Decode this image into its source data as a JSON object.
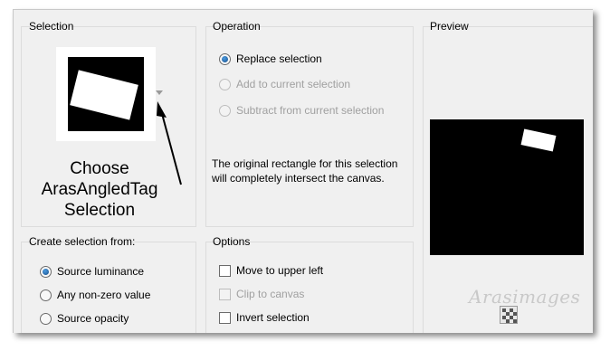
{
  "selection": {
    "title": "Selection",
    "annotation_lines": [
      "Choose",
      "ArasAngledTag",
      "Selection"
    ]
  },
  "operation": {
    "title": "Operation",
    "options": [
      {
        "label": "Replace selection",
        "checked": true,
        "enabled": true
      },
      {
        "label": "Add to current selection",
        "checked": false,
        "enabled": false
      },
      {
        "label": "Subtract from current selection",
        "checked": false,
        "enabled": false
      }
    ],
    "description": "The original rectangle for this selection will completely intersect the canvas."
  },
  "preview": {
    "title": "Preview",
    "watermark": "Arasimages",
    "icon": "checkerboard-icon"
  },
  "create_from": {
    "title": "Create selection from:",
    "options": [
      {
        "label": "Source luminance",
        "checked": true
      },
      {
        "label": "Any non-zero value",
        "checked": false
      },
      {
        "label": "Source opacity",
        "checked": false
      }
    ]
  },
  "options": {
    "title": "Options",
    "items": [
      {
        "label": "Move to upper left",
        "checked": false,
        "enabled": true
      },
      {
        "label": "Clip to canvas",
        "checked": false,
        "enabled": false
      },
      {
        "label": "Invert selection",
        "checked": false,
        "enabled": true
      }
    ]
  }
}
